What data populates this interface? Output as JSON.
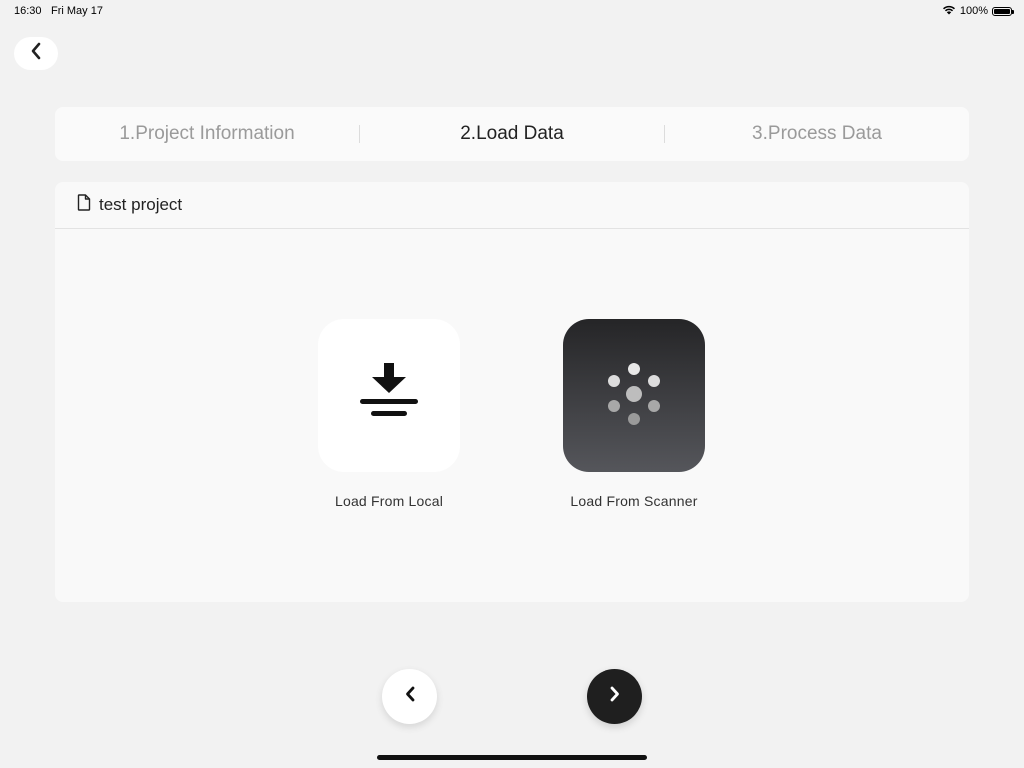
{
  "status_bar": {
    "time": "16:30",
    "date": "Fri May 17",
    "battery_text": "100%"
  },
  "stepper": {
    "steps": [
      {
        "label": "1.Project Information",
        "active": false
      },
      {
        "label": "2.Load Data",
        "active": true
      },
      {
        "label": "3.Process Data",
        "active": false
      }
    ]
  },
  "project": {
    "name": "test project",
    "icon": "document-icon"
  },
  "load_options": [
    {
      "label": "Load From Local",
      "icon": "download-icon"
    },
    {
      "label": "Load From Scanner",
      "icon": "scanner-dots-icon"
    }
  ],
  "navigation": {
    "back_icon": "chevron-left-icon",
    "prev_icon": "chevron-left-icon",
    "next_icon": "chevron-right-icon"
  },
  "colors": {
    "background": "#f2f2f2",
    "active_step": "#222222",
    "inactive_step": "#9a9a9a",
    "next_button": "#1f1f1f"
  }
}
